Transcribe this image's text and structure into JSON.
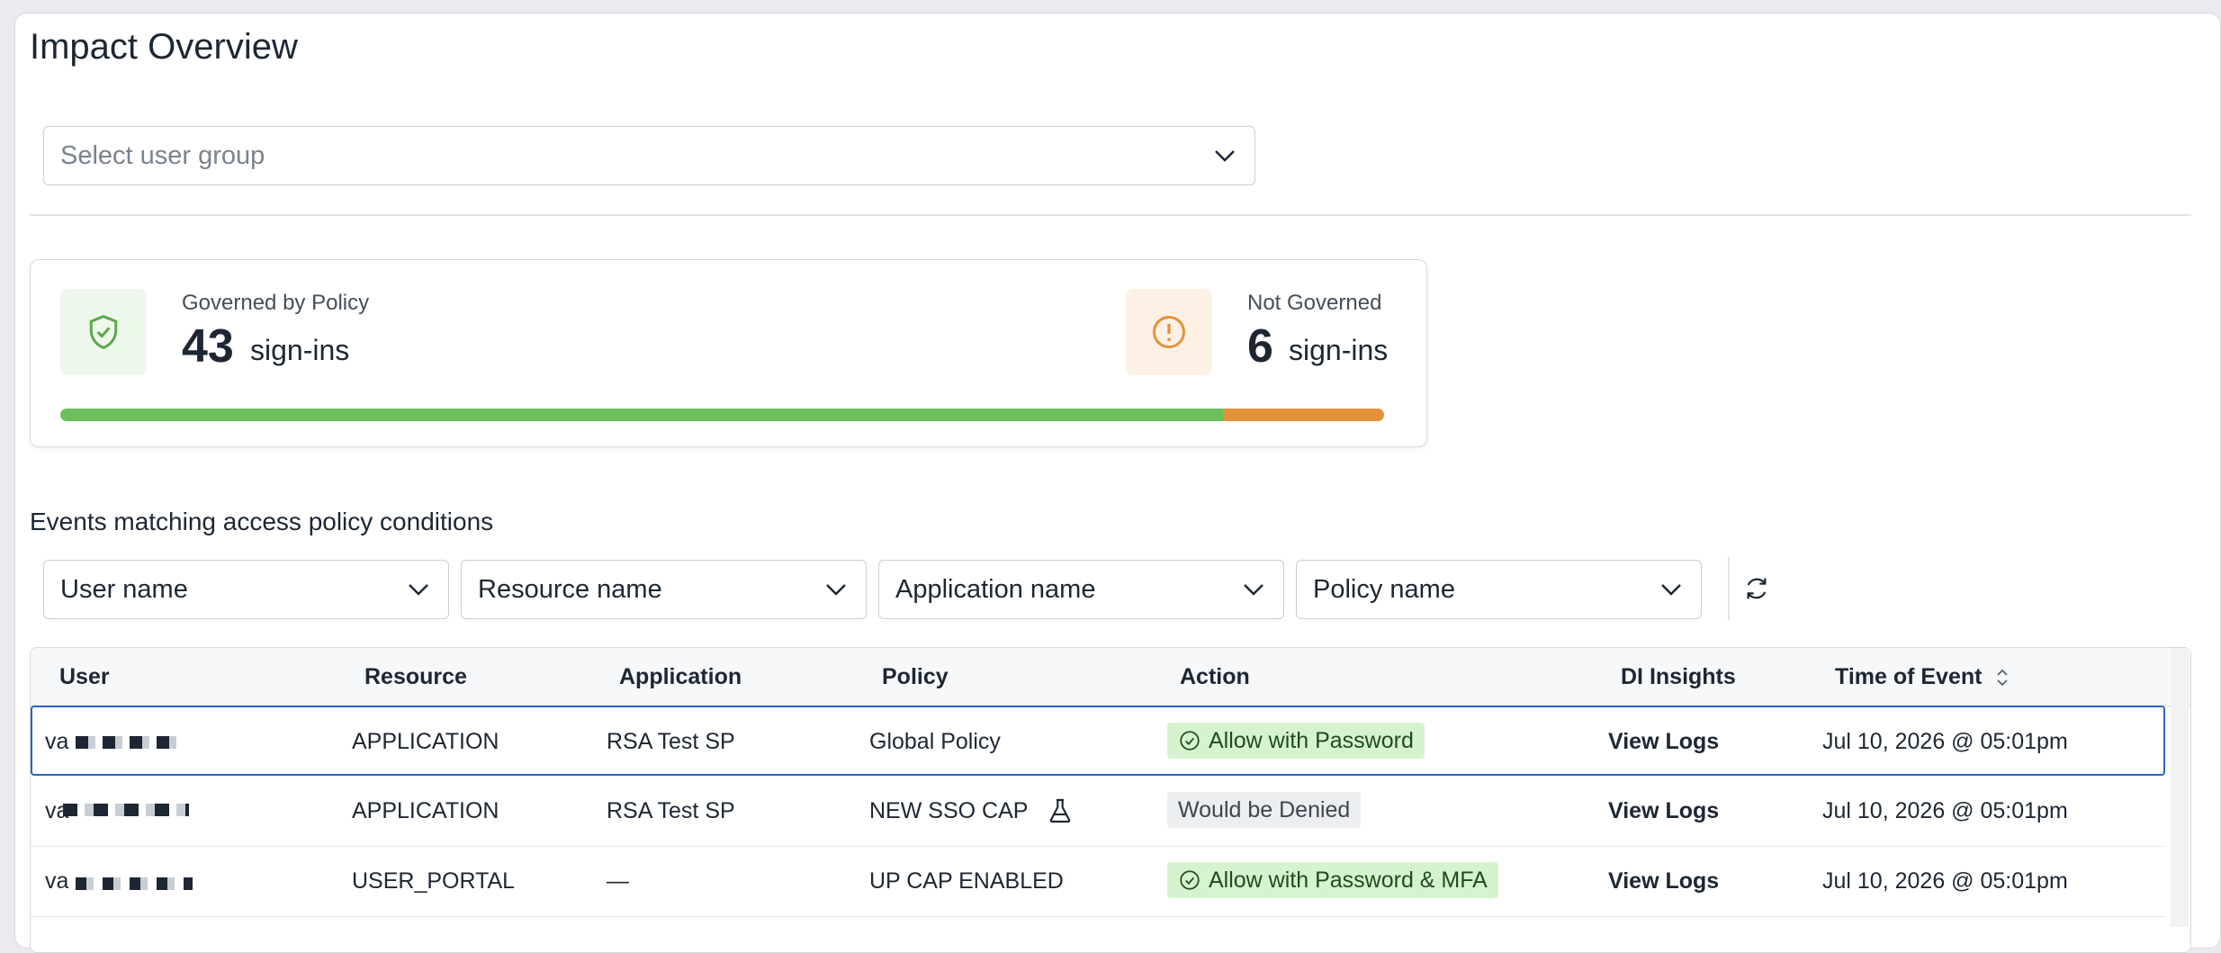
{
  "page": {
    "title": "Impact Overview",
    "user_group_placeholder": "Select user group"
  },
  "summary": {
    "governed": {
      "label": "Governed by Policy",
      "count": "43",
      "unit": "sign-ins",
      "color": "#6cbf5a",
      "icon": "shield-check-icon"
    },
    "not_governed": {
      "label": "Not Governed",
      "count": "6",
      "unit": "sign-ins",
      "color": "#e5913a",
      "icon": "alert-circle-icon"
    },
    "governed_fraction": 0.878
  },
  "events": {
    "title": "Events matching access policy conditions",
    "filters": [
      "User name",
      "Resource name",
      "Application name",
      "Policy name"
    ],
    "columns": [
      "User",
      "Resource",
      "Application",
      "Policy",
      "Action",
      "DI Insights",
      "Time of Event"
    ],
    "rows": [
      {
        "user": "va",
        "resource": "APPLICATION",
        "application": "RSA Test SP",
        "policy": "Global Policy",
        "action": "Allow with Password",
        "action_type": "allow",
        "insights": "View Logs",
        "time": "Jul 10, 2026 @ 05:01pm"
      },
      {
        "user": "va",
        "resource": "APPLICATION",
        "application": "RSA Test SP",
        "policy": "NEW SSO CAP",
        "action": "Would be Denied",
        "action_type": "deny",
        "insights": "View Logs",
        "time": "Jul 10, 2026 @ 05:01pm"
      },
      {
        "user": "va",
        "resource": "USER_PORTAL",
        "application": "—",
        "policy": "UP CAP ENABLED",
        "action": "Allow with Password & MFA",
        "action_type": "allow",
        "insights": "View Logs",
        "time": "Jul 10, 2026 @ 05:01pm"
      }
    ]
  }
}
